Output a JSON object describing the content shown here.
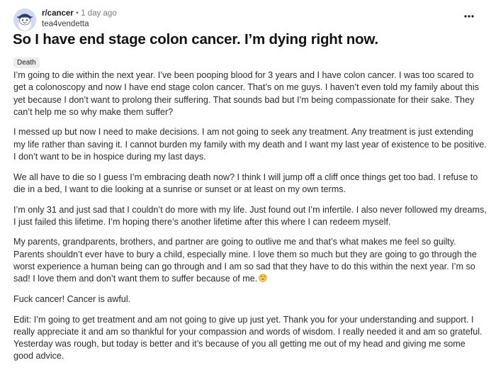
{
  "post": {
    "subreddit": "r/cancer",
    "separator": "•",
    "time_ago": "1 day ago",
    "author": "tea4vendetta",
    "more_icon": "more-horizontal-icon",
    "title": "So I have end stage colon cancer. I’m dying right now.",
    "flair": "Death",
    "paragraphs": [
      "I’m going to die within the next year. I’ve been pooping blood for 3 years and I have colon cancer. I was too scared to get a colonoscopy and now I have end stage colon cancer. That’s on me guys. I haven’t even told my family about this yet because I don’t want to prolong their suffering. That sounds bad but I’m being compassionate for their sake. They can’t help me so why make them suffer?",
      "I messed up but now I need to make decisions. I am not going to seek any treatment. Any treatment is just extending my life rather than saving it. I cannot burden my family with my death and I want my last year of existence to be positive. I don’t want to be in hospice during my last days.",
      "We all have to die so I guess I’m embracing death now? I think I will jump off a cliff once things get too bad. I refuse to die in a bed, I want to die looking at a sunrise or sunset or at least on my own terms.",
      "I’m only 31 and just sad that I couldn’t do more with my life. Just found out I’m infertile. I also never followed my dreams, I just failed this lifetime. I’m hoping there’s another lifetime after this where I can redeem myself.",
      "My parents, grandparents, brothers, and partner are going to outlive me and that’s what makes me feel so guilty. Parents shouldn’t ever have to bury a child, especially mine. I love them so much but they are going to go through the worst experience a human being can go through and I am so sad that they have to do this within the next year. I’m so sad! I love them and don’t want them to suffer because of me.",
      "Fuck cancer! Cancer is awful.",
      "Edit: I’m going to get treatment and am not going to give up just yet. Thank you for your understanding and support. I really appreciate it and am so thankful for your compassion and words of wisdom. I really needed it and am so grateful. Yesterday was rough, but today is better and it’s because of you all getting me out of my head and giving me some good advice."
    ],
    "emoji_icon": "grinning-sweat-emoji-icon"
  }
}
